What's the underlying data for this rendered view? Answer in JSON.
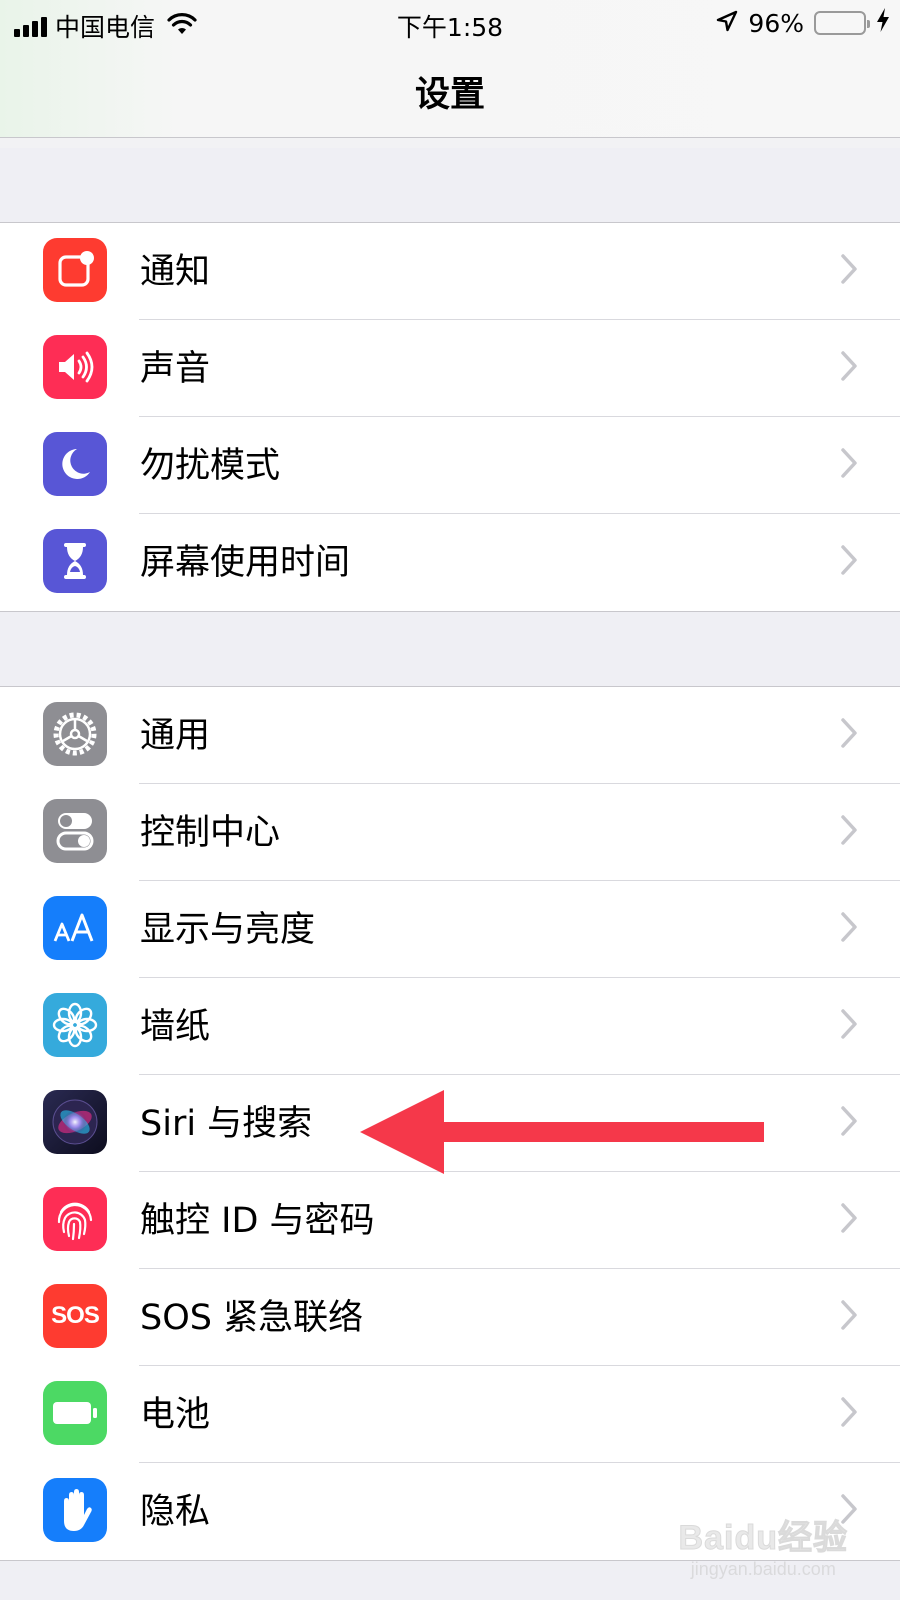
{
  "status_bar": {
    "carrier": "中国电信",
    "time": "下午1:58",
    "battery_percent": "96%",
    "battery_level": 0.96,
    "icons": [
      "signal-icon",
      "wifi-icon",
      "location-icon",
      "battery-icon",
      "charging-icon"
    ]
  },
  "nav": {
    "title": "设置"
  },
  "groups": [
    {
      "items": [
        {
          "label": "通知",
          "icon": "notifications-icon",
          "color": "#fe3b30"
        },
        {
          "label": "声音",
          "icon": "sounds-icon",
          "color": "#fe2d55"
        },
        {
          "label": "勿扰模式",
          "icon": "moon-icon",
          "color": "#5856d6"
        },
        {
          "label": "屏幕使用时间",
          "icon": "hourglass-icon",
          "color": "#5856d6"
        }
      ]
    },
    {
      "items": [
        {
          "label": "通用",
          "icon": "gear-icon",
          "color": "#8e8e93"
        },
        {
          "label": "控制中心",
          "icon": "toggles-icon",
          "color": "#8e8e93"
        },
        {
          "label": "显示与亮度",
          "icon": "text-size-icon",
          "color": "#157efb"
        },
        {
          "label": "墙纸",
          "icon": "flower-icon",
          "color": "#35aadc"
        },
        {
          "label": "Siri 与搜索",
          "icon": "siri-icon",
          "color": "#1d1d3a"
        },
        {
          "label": "触控 ID 与密码",
          "icon": "fingerprint-icon",
          "color": "#fe2d55"
        },
        {
          "label": "SOS 紧急联络",
          "icon": "sos-icon",
          "color": "#fe3b30",
          "icon_text": "SOS"
        },
        {
          "label": "电池",
          "icon": "battery-setting-icon",
          "color": "#4cd964"
        },
        {
          "label": "隐私",
          "icon": "hand-icon",
          "color": "#157efb"
        }
      ]
    }
  ],
  "annotation": {
    "type": "red-arrow",
    "points_to": "Siri 与搜索",
    "color": "#f5384a"
  },
  "watermark": {
    "main": "Baidu经验",
    "sub": "jingyan.baidu.com"
  }
}
